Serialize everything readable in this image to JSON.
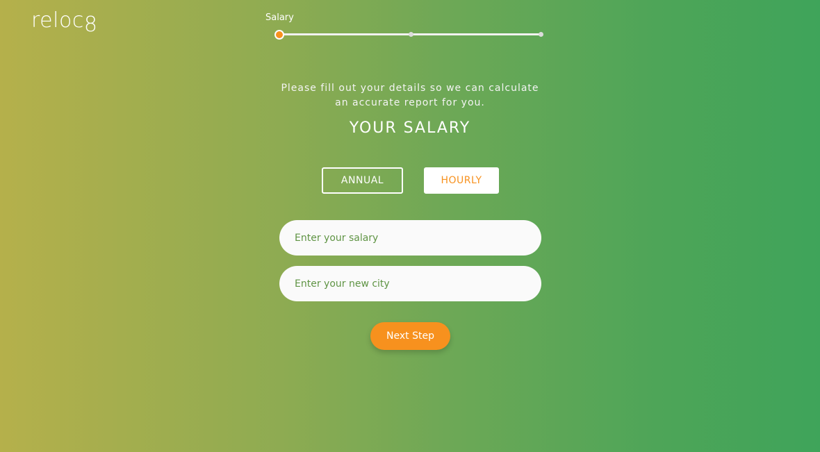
{
  "brand": {
    "logo_prefix": "reloc",
    "logo_suffix": "8"
  },
  "progress": {
    "current_step_label": "Salary",
    "current_step": 1,
    "total_steps": 3
  },
  "intro": {
    "line1": "Please fill out your details so we can calculate",
    "line2": "an accurate report for you."
  },
  "title": "YOUR SALARY",
  "pay_type": {
    "annual_label": "ANNUAL",
    "hourly_label": "HOURLY",
    "selected": "hourly"
  },
  "form": {
    "salary_value": "",
    "salary_placeholder": "Enter your salary",
    "city_value": "",
    "city_placeholder": "Enter your new city"
  },
  "next_button_label": "Next Step",
  "colors": {
    "accent": "#f7911e",
    "gradient_start": "#b5b04b",
    "gradient_end": "#3fa45a"
  }
}
